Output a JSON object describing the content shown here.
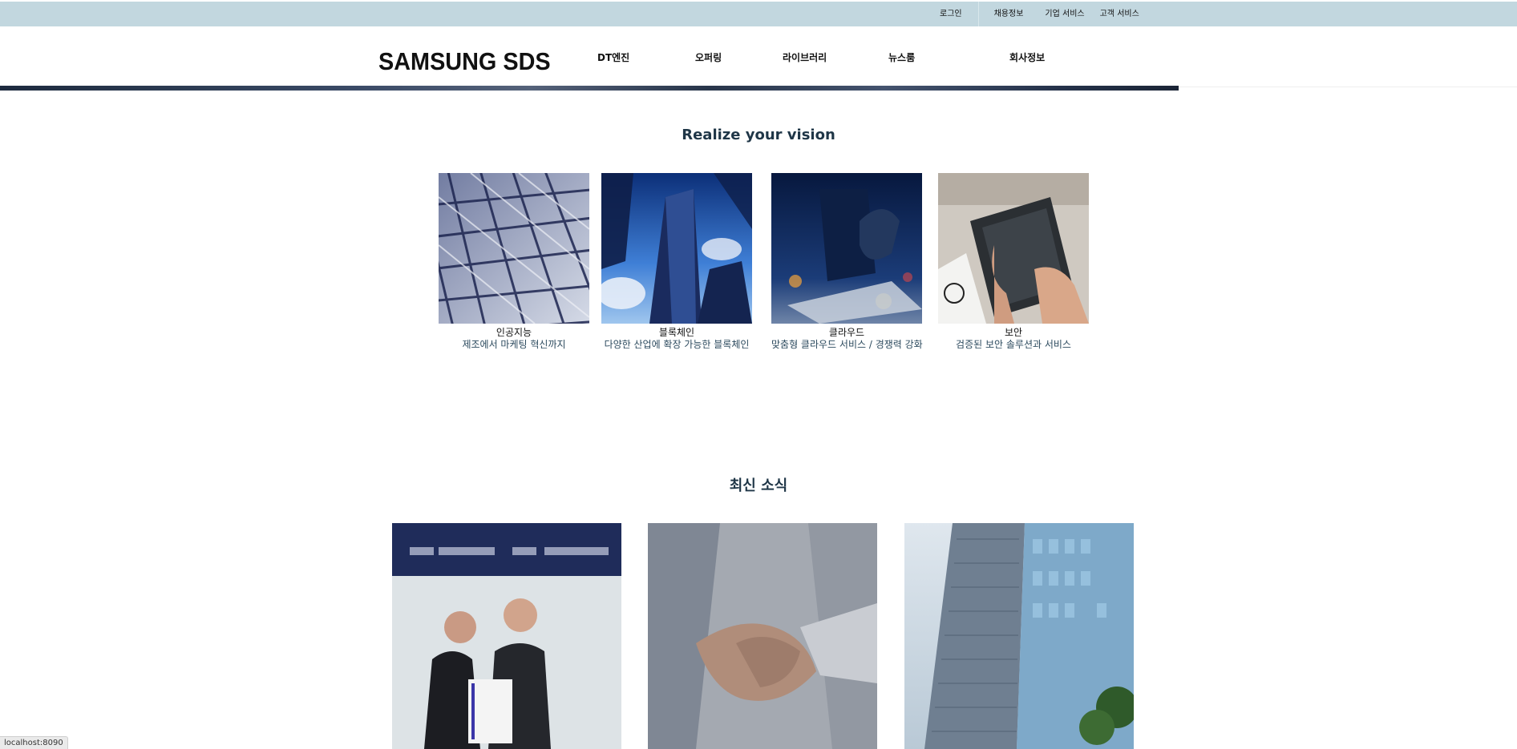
{
  "topbar": {
    "login": "로그인",
    "links": [
      "채용정보",
      "기업 서비스",
      "고객 서비스"
    ]
  },
  "header": {
    "logo": "SAMSUNG SDS",
    "menu": [
      "DT엔진",
      "오퍼링",
      "라이브러리",
      "뉴스룸",
      "회사정보"
    ]
  },
  "vision": {
    "title": "Realize your vision",
    "cards": [
      {
        "title": "인공지능",
        "desc": "제조에서 마케팅 혁신까지",
        "image": "glass-lattice-ceiling"
      },
      {
        "title": "블록체인",
        "desc": "다양한 산업에 확장 가능한 블록체인",
        "image": "skyscrapers-looking-up"
      },
      {
        "title": "클라우드",
        "desc": "맞춤형 클라우드 서비스 / 경쟁력 강화",
        "image": "hand-on-laptop"
      },
      {
        "title": "보안",
        "desc": "검증된 보안 솔루션과 서비스",
        "image": "hands-on-tablet"
      }
    ]
  },
  "news": {
    "title": "최신 소식",
    "items": [
      {
        "image": "two-men-holding-certificate"
      },
      {
        "image": "handshake"
      },
      {
        "image": "office-building"
      }
    ]
  },
  "status": {
    "url": "localhost:8090"
  },
  "colors": {
    "topbar": "#c2d7df",
    "title": "#1f3647",
    "desc": "#2c4a5e"
  }
}
